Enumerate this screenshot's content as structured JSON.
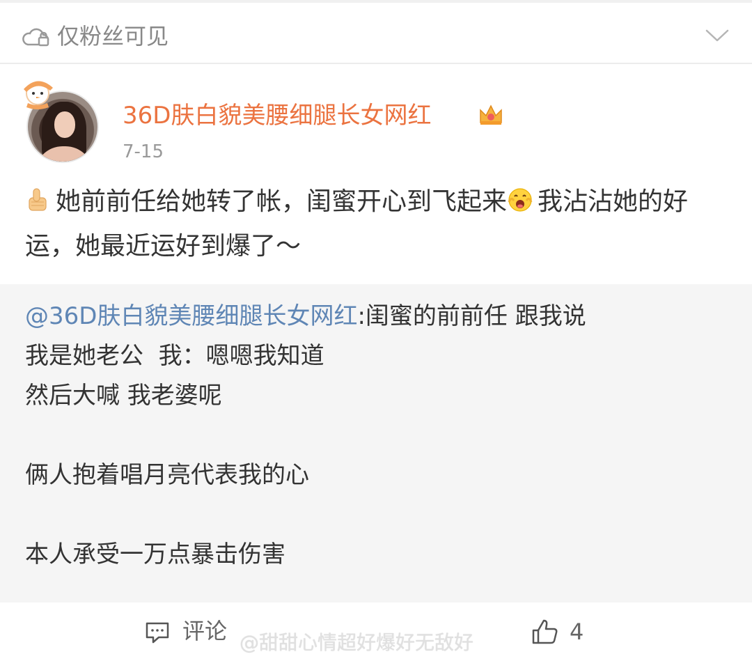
{
  "visibility": {
    "label": "仅粉丝可见",
    "icon": "lock-cloud-icon"
  },
  "author": {
    "name": "36D肤白貌美腰细腿长女网红",
    "badge_icon": "crown-badge-icon",
    "date": "7-15",
    "name_color": "#eb7340"
  },
  "post": {
    "text_part1": "她前前任给她转了帐，闺蜜开心到飞起来",
    "text_part2": "我沾沾她的好运，她最近运好到爆了～",
    "leading_emoji": "thumbs-up-icon",
    "inline_emoji": "excited-face-icon"
  },
  "repost": {
    "mention": "@36D肤白貌美腰细腿长女网红",
    "body": ":闺蜜的前前任 跟我说\n我是她老公  我：嗯嗯我知道\n然后大喊 我老婆呢\n\n俩人抱着唱月亮代表我的心\n\n本人承受一万点暴击伤害",
    "mention_color": "#5f86b5",
    "background": "#f5f5f5"
  },
  "actions": {
    "comment_label": "评论",
    "like_count": "4",
    "watermark": "@甜甜心情超好爆好无敌好"
  }
}
